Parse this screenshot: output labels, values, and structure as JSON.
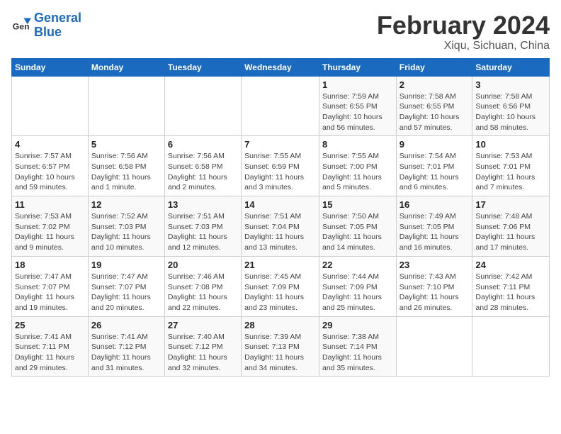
{
  "header": {
    "logo_line1": "General",
    "logo_line2": "Blue",
    "month": "February 2024",
    "location": "Xiqu, Sichuan, China"
  },
  "days_of_week": [
    "Sunday",
    "Monday",
    "Tuesday",
    "Wednesday",
    "Thursday",
    "Friday",
    "Saturday"
  ],
  "weeks": [
    [
      {
        "num": "",
        "detail": ""
      },
      {
        "num": "",
        "detail": ""
      },
      {
        "num": "",
        "detail": ""
      },
      {
        "num": "",
        "detail": ""
      },
      {
        "num": "1",
        "detail": "Sunrise: 7:59 AM\nSunset: 6:55 PM\nDaylight: 10 hours and 56 minutes."
      },
      {
        "num": "2",
        "detail": "Sunrise: 7:58 AM\nSunset: 6:55 PM\nDaylight: 10 hours and 57 minutes."
      },
      {
        "num": "3",
        "detail": "Sunrise: 7:58 AM\nSunset: 6:56 PM\nDaylight: 10 hours and 58 minutes."
      }
    ],
    [
      {
        "num": "4",
        "detail": "Sunrise: 7:57 AM\nSunset: 6:57 PM\nDaylight: 10 hours and 59 minutes."
      },
      {
        "num": "5",
        "detail": "Sunrise: 7:56 AM\nSunset: 6:58 PM\nDaylight: 11 hours and 1 minute."
      },
      {
        "num": "6",
        "detail": "Sunrise: 7:56 AM\nSunset: 6:58 PM\nDaylight: 11 hours and 2 minutes."
      },
      {
        "num": "7",
        "detail": "Sunrise: 7:55 AM\nSunset: 6:59 PM\nDaylight: 11 hours and 3 minutes."
      },
      {
        "num": "8",
        "detail": "Sunrise: 7:55 AM\nSunset: 7:00 PM\nDaylight: 11 hours and 5 minutes."
      },
      {
        "num": "9",
        "detail": "Sunrise: 7:54 AM\nSunset: 7:01 PM\nDaylight: 11 hours and 6 minutes."
      },
      {
        "num": "10",
        "detail": "Sunrise: 7:53 AM\nSunset: 7:01 PM\nDaylight: 11 hours and 7 minutes."
      }
    ],
    [
      {
        "num": "11",
        "detail": "Sunrise: 7:53 AM\nSunset: 7:02 PM\nDaylight: 11 hours and 9 minutes."
      },
      {
        "num": "12",
        "detail": "Sunrise: 7:52 AM\nSunset: 7:03 PM\nDaylight: 11 hours and 10 minutes."
      },
      {
        "num": "13",
        "detail": "Sunrise: 7:51 AM\nSunset: 7:03 PM\nDaylight: 11 hours and 12 minutes."
      },
      {
        "num": "14",
        "detail": "Sunrise: 7:51 AM\nSunset: 7:04 PM\nDaylight: 11 hours and 13 minutes."
      },
      {
        "num": "15",
        "detail": "Sunrise: 7:50 AM\nSunset: 7:05 PM\nDaylight: 11 hours and 14 minutes."
      },
      {
        "num": "16",
        "detail": "Sunrise: 7:49 AM\nSunset: 7:05 PM\nDaylight: 11 hours and 16 minutes."
      },
      {
        "num": "17",
        "detail": "Sunrise: 7:48 AM\nSunset: 7:06 PM\nDaylight: 11 hours and 17 minutes."
      }
    ],
    [
      {
        "num": "18",
        "detail": "Sunrise: 7:47 AM\nSunset: 7:07 PM\nDaylight: 11 hours and 19 minutes."
      },
      {
        "num": "19",
        "detail": "Sunrise: 7:47 AM\nSunset: 7:07 PM\nDaylight: 11 hours and 20 minutes."
      },
      {
        "num": "20",
        "detail": "Sunrise: 7:46 AM\nSunset: 7:08 PM\nDaylight: 11 hours and 22 minutes."
      },
      {
        "num": "21",
        "detail": "Sunrise: 7:45 AM\nSunset: 7:09 PM\nDaylight: 11 hours and 23 minutes."
      },
      {
        "num": "22",
        "detail": "Sunrise: 7:44 AM\nSunset: 7:09 PM\nDaylight: 11 hours and 25 minutes."
      },
      {
        "num": "23",
        "detail": "Sunrise: 7:43 AM\nSunset: 7:10 PM\nDaylight: 11 hours and 26 minutes."
      },
      {
        "num": "24",
        "detail": "Sunrise: 7:42 AM\nSunset: 7:11 PM\nDaylight: 11 hours and 28 minutes."
      }
    ],
    [
      {
        "num": "25",
        "detail": "Sunrise: 7:41 AM\nSunset: 7:11 PM\nDaylight: 11 hours and 29 minutes."
      },
      {
        "num": "26",
        "detail": "Sunrise: 7:41 AM\nSunset: 7:12 PM\nDaylight: 11 hours and 31 minutes."
      },
      {
        "num": "27",
        "detail": "Sunrise: 7:40 AM\nSunset: 7:12 PM\nDaylight: 11 hours and 32 minutes."
      },
      {
        "num": "28",
        "detail": "Sunrise: 7:39 AM\nSunset: 7:13 PM\nDaylight: 11 hours and 34 minutes."
      },
      {
        "num": "29",
        "detail": "Sunrise: 7:38 AM\nSunset: 7:14 PM\nDaylight: 11 hours and 35 minutes."
      },
      {
        "num": "",
        "detail": ""
      },
      {
        "num": "",
        "detail": ""
      }
    ]
  ]
}
